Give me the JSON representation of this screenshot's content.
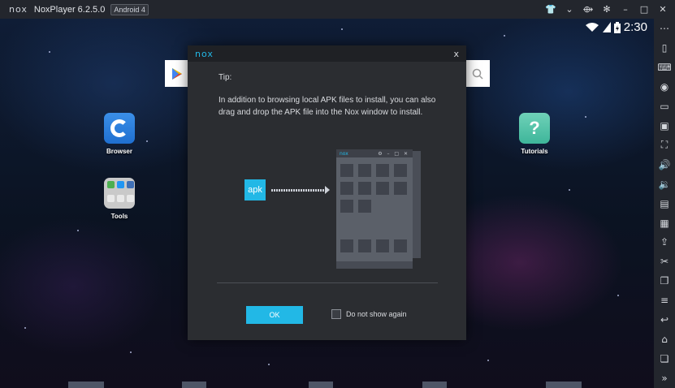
{
  "titlebar": {
    "logo": "nox",
    "app_title": "NoxPlayer 6.2.5.0",
    "android_badge": "Android 4",
    "icons": [
      "shirt-icon",
      "chevron-down-icon",
      "pin-icon",
      "gear-icon",
      "minimize-icon",
      "maximize-icon",
      "close-icon"
    ],
    "glyphs": [
      "👕",
      "⌄",
      "⟴",
      "✻",
      "–",
      "□",
      "✕"
    ]
  },
  "status_bar": {
    "time": "2:30"
  },
  "desktop": {
    "browser_label": "Browser",
    "tools_label": "Tools",
    "tutorials_label": "Tutorials",
    "tutorials_glyph": "?",
    "tools_colors": [
      "#4caf50",
      "#2196f3",
      "#3f6fb5",
      "#e8e8e8",
      "#e8e8e8",
      "#e8e8e8"
    ]
  },
  "dialog": {
    "logo": "nox",
    "close": "x",
    "tip_title": "Tip:",
    "tip_body": "In addition to browsing local APK files to install, you can also drag and drop the APK file into the Nox window to install.",
    "illustration": {
      "apk_label": "apk",
      "mini_logo": "nox",
      "mini_controls": "⚙ – □ ✕"
    },
    "ok_label": "OK",
    "checkbox_label": "Do not show again",
    "checkbox_checked": false,
    "accent_color": "#22b8e6"
  },
  "sidebar": {
    "icons": [
      {
        "name": "more-icon",
        "glyph": "⋯"
      },
      {
        "name": "shake-icon",
        "glyph": "▯"
      },
      {
        "name": "keyboard-icon",
        "glyph": "⌨"
      },
      {
        "name": "location-icon",
        "glyph": "◉"
      },
      {
        "name": "screen-icon",
        "glyph": "▭"
      },
      {
        "name": "apk-install-icon",
        "glyph": "▣"
      },
      {
        "name": "fullscreen-icon",
        "glyph": "⛶"
      },
      {
        "name": "volume-up-icon",
        "glyph": "🔊"
      },
      {
        "name": "volume-down-icon",
        "glyph": "🔉"
      },
      {
        "name": "toolbox-icon",
        "glyph": "▤"
      },
      {
        "name": "multi-drive-icon",
        "glyph": "▦"
      },
      {
        "name": "import-icon",
        "glyph": "⇪"
      },
      {
        "name": "scissors-icon",
        "glyph": "✂"
      },
      {
        "name": "copy-icon",
        "glyph": "❐"
      },
      {
        "name": "menu-icon",
        "glyph": "≡"
      },
      {
        "name": "back-icon",
        "glyph": "↩"
      },
      {
        "name": "home-icon",
        "glyph": "⌂"
      },
      {
        "name": "recent-apps-icon",
        "glyph": "❏"
      },
      {
        "name": "expand-icon",
        "glyph": "»"
      }
    ]
  }
}
